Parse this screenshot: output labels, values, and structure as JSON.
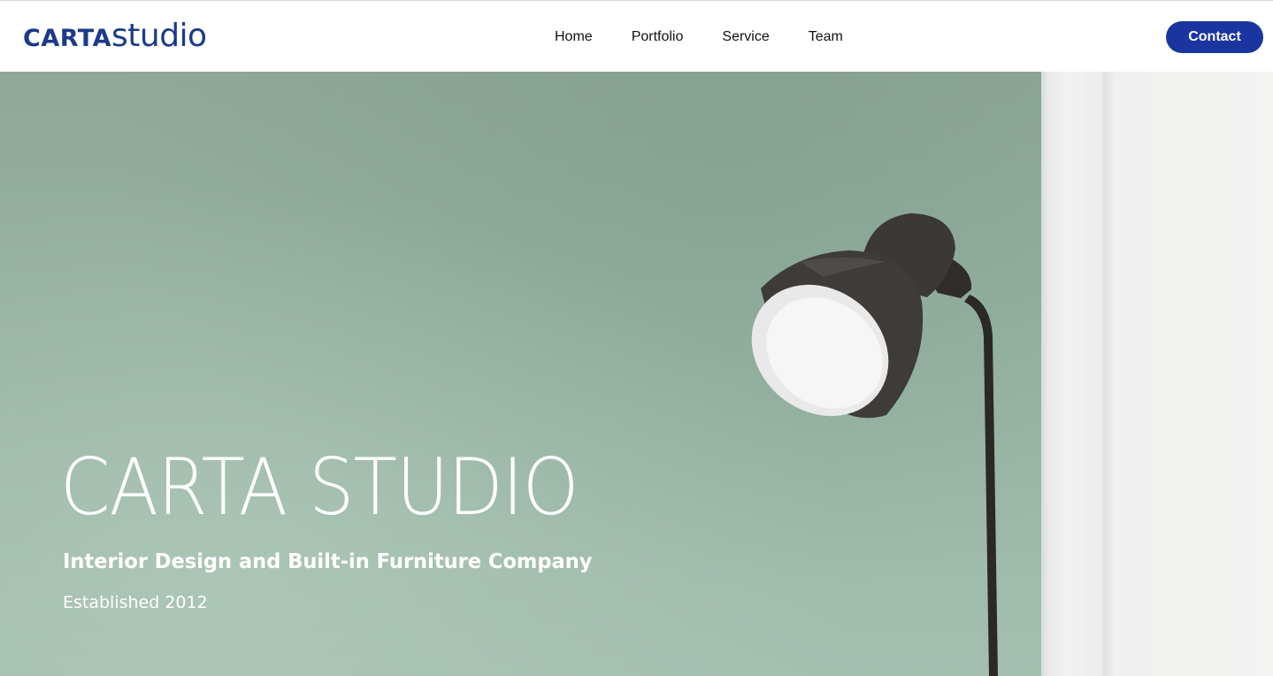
{
  "header": {
    "logo": {
      "bold": "CARTA",
      "light": "studio"
    },
    "nav": [
      {
        "label": "Home"
      },
      {
        "label": "Portfolio"
      },
      {
        "label": "Service"
      },
      {
        "label": "Team"
      }
    ],
    "contact_label": "Contact"
  },
  "hero": {
    "title": "CARTA STUDIO",
    "subtitle": "Interior Design and Built-in Furniture Company",
    "established": "Established 2012",
    "image_subject": "floor-lamp-against-green-wall"
  },
  "colors": {
    "brand": "#1c3a8a",
    "button": "#1a35a0",
    "wall": "#94b2a2",
    "text_on_hero": "#ffffff"
  }
}
